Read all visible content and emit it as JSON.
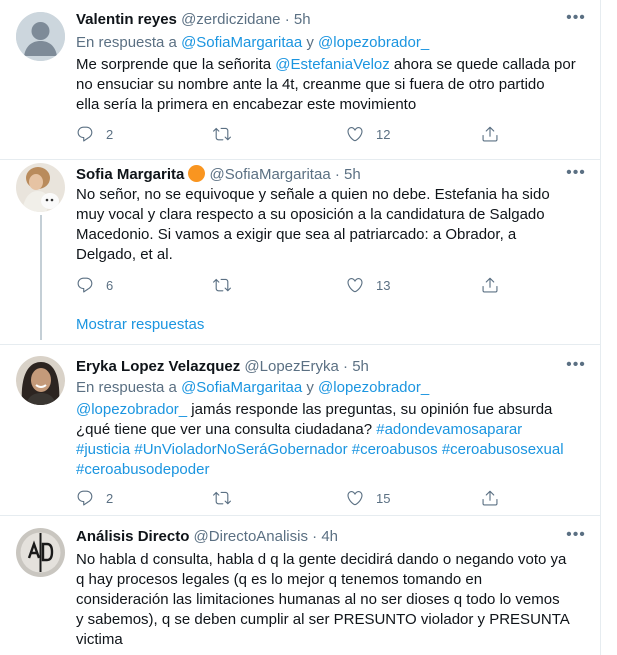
{
  "tweets": [
    {
      "name": "Valentin reyes",
      "handle": "@zerdiczidane",
      "time": "· 5h",
      "reply_prefix": "En respuesta a ",
      "reply_to_1": "@SofiaMargaritaa",
      "reply_and": " y ",
      "reply_to_2": "@lopezobrador_",
      "body": {
        "l1_a": "Me sorprende que la señorita ",
        "l1_mention": "@EstefaniaVeloz",
        "l1_b": " ahora se quede callada por",
        "l2": "no ensuciar su nombre ante la 4t, creanme que si fuera de otro partido",
        "l3": "ella sería la primera en encabezar este movimiento"
      },
      "replies": "2",
      "retweets": "",
      "likes": "12"
    },
    {
      "name": "Sofia Margarita",
      "handle": "@SofiaMargaritaa",
      "time": "· 5h",
      "body": {
        "l1": "No señor, no se equivoque y señale a quien no debe. Estefania ha sido",
        "l2": "muy vocal y clara respecto a su oposición a la candidatura de Salgado",
        "l3": "Macedonio. Si vamos a exigir que sea al patriarcado: a Obrador, a",
        "l4": "Delgado, et al."
      },
      "replies": "6",
      "retweets": "",
      "likes": "13",
      "show_replies": "Mostrar respuestas"
    },
    {
      "name": "Eryka Lopez Velazquez",
      "handle": "@LopezEryka",
      "time": "· 5h",
      "reply_prefix": "En respuesta a ",
      "reply_to_1": "@SofiaMargaritaa",
      "reply_and": " y ",
      "reply_to_2": "@lopezobrador_",
      "body": {
        "l1_mention": "@lopezobrador_",
        "l1_b": " jamás responde las preguntas, su opinión fue absurda",
        "l2_a": "¿qué tiene que ver una consulta ciudadana? ",
        "l2_tag": "#adondevamosaparar",
        "l3_tag1": "#justicia",
        "l3_tag2": "#UnVioladorNoSeráGobernador",
        "l3_tag3": "#ceroabusos",
        "l3_tag4": "#ceroabusosexual",
        "l4_tag": "#ceroabusodepoder"
      },
      "replies": "2",
      "retweets": "",
      "likes": "15"
    },
    {
      "name": "Análisis Directo",
      "handle": "@DirectoAnalisis",
      "time": "· 4h",
      "body": {
        "l1": "No habla d consulta, habla d q la gente decidirá dando o negando voto ya",
        "l2": "q hay procesos legales (q es lo mejor q tenemos tomando en",
        "l3": "consideración las limitaciones humanas al no ser dioses q todo lo vemos",
        "l4": "y sabemos), q se deben cumplir al ser PRESUNTO violador y PRESUNTA",
        "l5": "victima"
      },
      "avatar_letters": "A D"
    }
  ],
  "more_label": "•••",
  "colors": {
    "link": "#1b95e0",
    "muted": "#5b7083",
    "divider": "#e6ecf0",
    "badge": "#f99520"
  },
  "icons": [
    "reply-icon",
    "retweet-icon",
    "like-icon",
    "share-icon",
    "more-icon"
  ]
}
